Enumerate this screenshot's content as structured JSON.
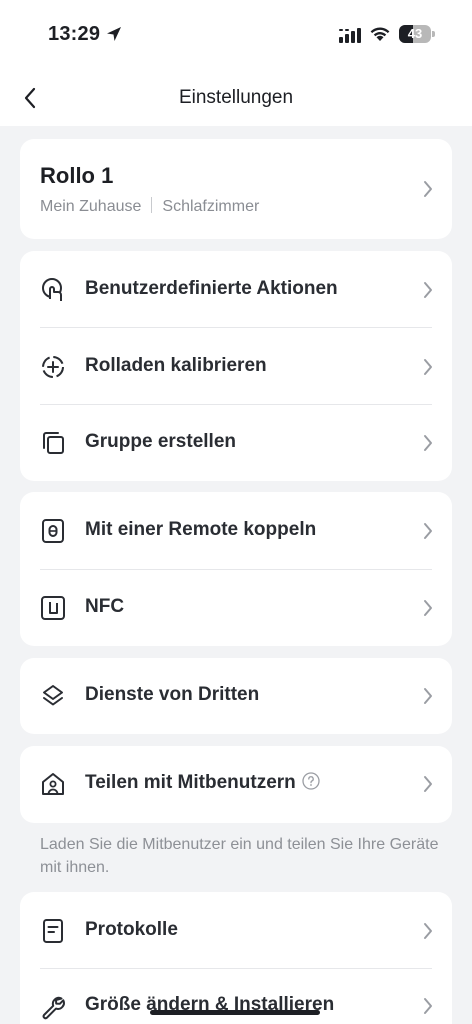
{
  "status_bar": {
    "time": "13:29",
    "battery_level": "43"
  },
  "nav": {
    "title": "Einstellungen"
  },
  "device": {
    "name": "Rollo 1",
    "home": "Mein Zuhause",
    "room": "Schlafzimmer"
  },
  "group1": [
    {
      "label": "Benutzerdefinierte Aktionen",
      "icon": "tap-hand-icon"
    },
    {
      "label": "Rolladen kalibrieren",
      "icon": "calibrate-target-icon"
    },
    {
      "label": "Gruppe erstellen",
      "icon": "group-copy-icon"
    }
  ],
  "group2": [
    {
      "label": "Mit einer Remote koppeln",
      "icon": "remote-icon"
    },
    {
      "label": "NFC",
      "icon": "nfc-icon"
    }
  ],
  "group3": [
    {
      "label": "Dienste von Dritten",
      "icon": "layers-icon"
    }
  ],
  "group4": [
    {
      "label": "Teilen mit Mitbenutzern",
      "icon": "home-share-icon"
    }
  ],
  "share_note": "Laden Sie die Mitbenutzer ein und teilen Sie Ihre Geräte mit ihnen.",
  "group5": [
    {
      "label": "Protokolle",
      "icon": "log-document-icon"
    },
    {
      "label": "Größe ändern & Installieren",
      "icon": "wrench-icon"
    }
  ],
  "colors": {
    "background": "#f2f3f5",
    "card": "#ffffff",
    "text": "#1d1f24",
    "secondary_text": "#8a8d93"
  }
}
